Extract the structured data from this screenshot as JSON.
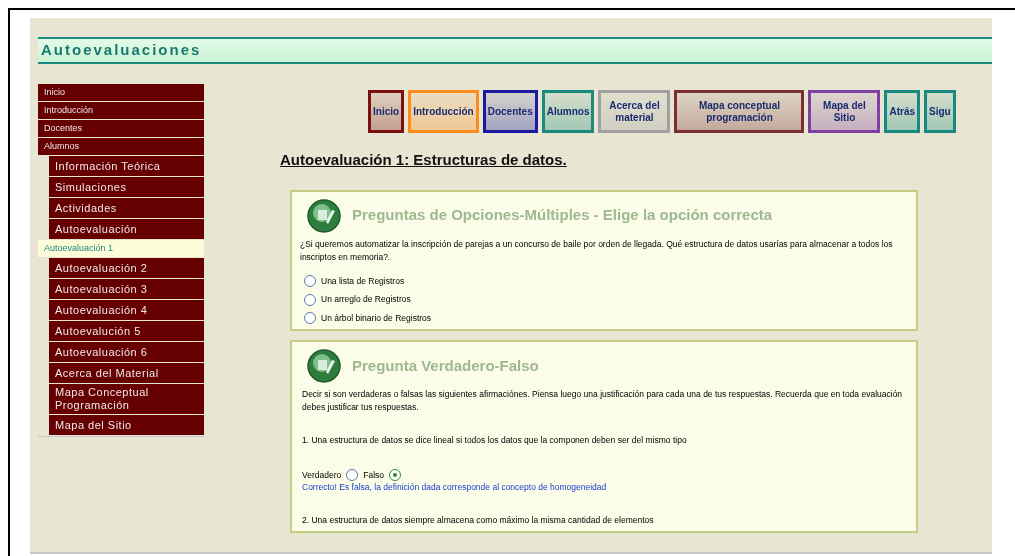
{
  "header": {
    "title": "Autoevaluaciones"
  },
  "sidebar": {
    "items": [
      {
        "label": "Inicio",
        "kind": "main",
        "selected": false
      },
      {
        "label": "Introducción",
        "kind": "main",
        "selected": false
      },
      {
        "label": "Docentes",
        "kind": "main",
        "selected": false
      },
      {
        "label": "Alumnos",
        "kind": "main",
        "selected": false
      },
      {
        "label": "Información Teórica",
        "kind": "sub",
        "selected": false
      },
      {
        "label": "Simulaciones",
        "kind": "sub",
        "selected": false
      },
      {
        "label": "Actividades",
        "kind": "sub",
        "selected": false
      },
      {
        "label": "Autoevaluación",
        "kind": "sub",
        "selected": false
      },
      {
        "label": "Autoevaluación 1",
        "kind": "main",
        "selected": true
      },
      {
        "label": "Autoevaluación 2",
        "kind": "sub",
        "selected": false
      },
      {
        "label": "Autoevaluación 3",
        "kind": "sub",
        "selected": false
      },
      {
        "label": "Autoevaluación 4",
        "kind": "sub",
        "selected": false
      },
      {
        "label": "Autoevalución 5",
        "kind": "sub",
        "selected": false
      },
      {
        "label": "Autoevaluación 6",
        "kind": "sub",
        "selected": false
      },
      {
        "label": "Acerca del Material",
        "kind": "sub",
        "selected": false
      },
      {
        "label": "Mapa Conceptual Programación",
        "kind": "sub",
        "selected": false
      },
      {
        "label": "Mapa del Sitio",
        "kind": "sub",
        "selected": false
      }
    ]
  },
  "nav_buttons": [
    {
      "label": "Inicio",
      "color": "#7a1010"
    },
    {
      "label": "Introducción",
      "color": "#ff8c1a"
    },
    {
      "label": "Docentes",
      "color": "#1a1aa0"
    },
    {
      "label": "Alumnos",
      "color": "#1a8a80"
    },
    {
      "label": "Acerca del material",
      "color": "#a0a0a0"
    },
    {
      "label": "Mapa conceptual programación",
      "color": "#7a3030"
    },
    {
      "label": "Mapa del Sitio",
      "color": "#8040a0"
    },
    {
      "label": "Atrás",
      "color": "#1a8a80"
    },
    {
      "label": "Sigu",
      "color": "#1a8a80"
    }
  ],
  "page_title": "Autoevaluación 1: Estructuras de datos.",
  "sections": [
    {
      "title": "Preguntas de Opciones-Múltiples - Elige la opción correcta",
      "kind": "multiple",
      "question": "¿Si queremos automatizar la inscripción de parejas a un concurso de baile por orden de llegada. Qué estructura de datos usarías para almacenar a todos los inscriptos en memoria?.",
      "options": [
        {
          "label": "Una lista de Registros",
          "selected": false
        },
        {
          "label": "Un arreglo de Registros",
          "selected": false
        },
        {
          "label": "Un árbol binario de Registros",
          "selected": false
        }
      ]
    },
    {
      "title": "Pregunta Verdadero-Falso",
      "kind": "truefalse",
      "intro": "Decir si son verdaderas o falsas las siguientes afirmaciónes. Piensa luego una justificación para cada una de tus respuestas. Recuerda que en toda evaluación debes justificar tus respuestas.",
      "statements": [
        {
          "text": "1. Una estructura de datos se dice lineal si todos los datos que la componen deben ser del mismo tipo",
          "choices": [
            {
              "label": "Verdadero",
              "selected": false
            },
            {
              "label": "Falso",
              "selected": true
            }
          ],
          "feedback": "Correcto! Es falsa, la definición dada corresponde al concepto de homogeneidad"
        },
        {
          "text": "2. Una estructura de datos siempre almacena como máximo la misma cantidad de elementos"
        }
      ]
    }
  ]
}
